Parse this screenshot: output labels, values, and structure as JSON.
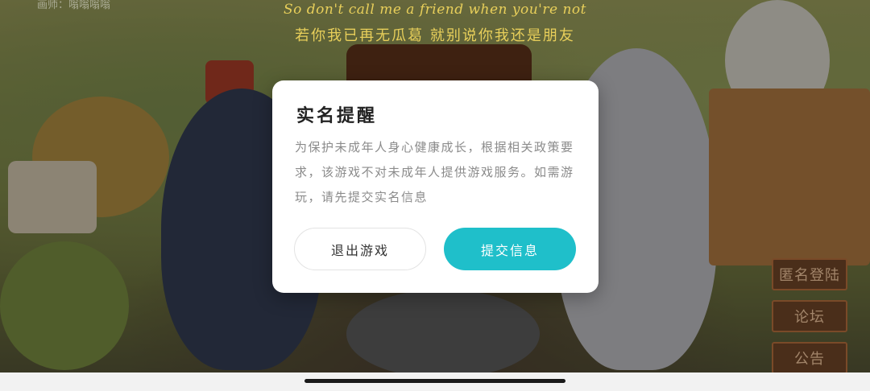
{
  "background": {
    "credit_text": "画师：嗡嗡嗡嗡",
    "lyric_english": "So don't call me a friend when you're not",
    "lyric_chinese": "若你我已再无瓜葛 就别说你我还是朋友"
  },
  "dialog": {
    "title": "实名提醒",
    "message": "为保护未成年人身心健康成长，根据相关政策要求，该游戏不对未成年人提供游戏服务。如需游玩，请先提交实名信息",
    "exit_button_label": "退出游戏",
    "submit_button_label": "提交信息"
  },
  "side_menu": {
    "items": [
      {
        "label": "匿名登陆"
      },
      {
        "label": "论坛"
      },
      {
        "label": "公告"
      }
    ]
  },
  "colors": {
    "accent": "#1fbfca",
    "lyric": "#e8cf5a",
    "side_button_bg": "#4a2e1a"
  }
}
